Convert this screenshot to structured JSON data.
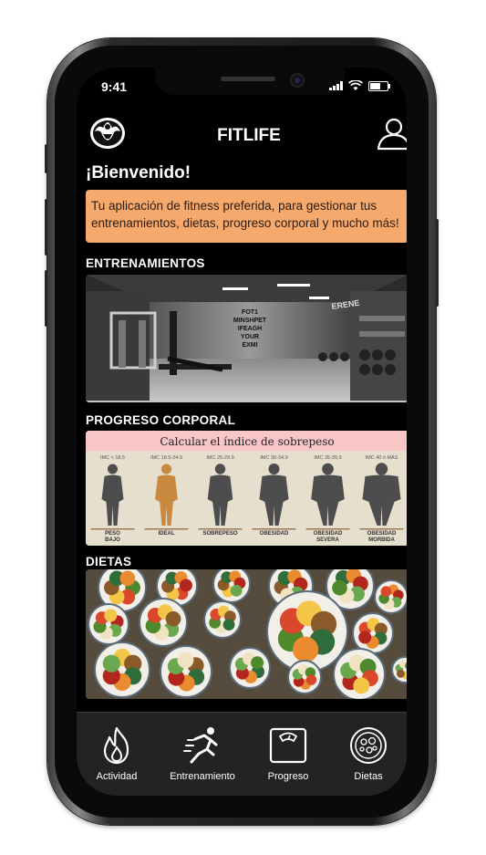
{
  "status_bar": {
    "time": "9:41"
  },
  "header": {
    "title": "FITLIFE"
  },
  "welcome": {
    "heading": "¡Bienvenido!"
  },
  "banner": {
    "text": "Tu aplicación de fitness preferida, para gestionar tus entrenamientos, dietas, progreso corporal y mucho más!"
  },
  "sections": {
    "training": {
      "title": "ENTRENAMIENTOS",
      "wall_text": [
        "FOT1",
        "MINSHPET",
        "IFEAGH",
        "YOUR",
        "EXMI"
      ],
      "side_text": "ERENE"
    },
    "progress": {
      "title": "PROGRESO CORPORAL",
      "chart_title": "Calcular el índice de sobrepeso",
      "categories": [
        {
          "range": "IMC < 18.5",
          "label": "PESO BAJO"
        },
        {
          "range": "IMC 18.5-24.9",
          "label": "IDEAL"
        },
        {
          "range": "IMC 25-29.9",
          "label": "SOBREPESO"
        },
        {
          "range": "IMC 30-34.9",
          "label": "OBESIDAD"
        },
        {
          "range": "IMC 35-39.9",
          "label": "OBESIDAD SEVERA"
        },
        {
          "range": "IMC 40 ó MÁS",
          "label": "OBESIDAD MORBIDA"
        }
      ]
    },
    "diets": {
      "title": "DIETAS"
    }
  },
  "nav": {
    "activity": "Actividad",
    "training": "Entrenamiento",
    "progress": "Progreso",
    "diets": "Dietas"
  },
  "colors": {
    "banner_bg": "#f6a96d",
    "nav_bg": "#232323",
    "chart_title_bg": "#f8c6c6",
    "chart_bg": "#e7dfce",
    "ideal_figure": "#c98a3f"
  }
}
